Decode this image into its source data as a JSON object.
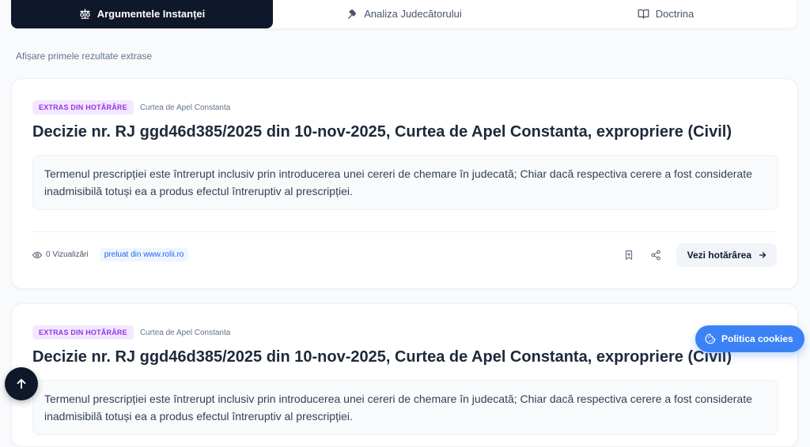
{
  "tabs": [
    {
      "label": "Argumentele Instanței",
      "icon": "scale-icon",
      "active": true
    },
    {
      "label": "Analiza Judecătorului",
      "icon": "gavel-icon",
      "active": false
    },
    {
      "label": "Doctrina",
      "icon": "book-icon",
      "active": false
    }
  ],
  "subtitle": "Afișare primele rezultate extrase",
  "results": [
    {
      "badge": "EXTRAS DIN HOTĂRÂRE",
      "court": "Curtea de Apel Constanta",
      "title": "Decizie nr. RJ ggd46d385/2025 din 10-nov-2025, Curtea de Apel Constanta, expropriere (Civil)",
      "excerpt": "Termenul prescripției este întrerupt inclusiv prin introducerea unei cereri de chemare în judecată; Chiar dacă respectiva cerere a fost considerate inadmisibilă totuși ea a produs efectul întreruptiv al prescripției.",
      "views": "0 Vizualizări",
      "source": "preluat din www.rolii.ro",
      "view_button": "Vezi hotărârea"
    },
    {
      "badge": "EXTRAS DIN HOTĂRÂRE",
      "court": "Curtea de Apel Constanta",
      "title": "Decizie nr. RJ ggd46d385/2025 din 10-nov-2025, Curtea de Apel Constanta, expropriere (Civil)",
      "excerpt": "Termenul prescripției este întrerupt inclusiv prin introducerea unei cereri de chemare în judecată; Chiar dacă respectiva cerere a fost considerate inadmisibilă totuși ea a produs efectul întreruptiv al prescripției."
    }
  ],
  "cookie_button": "Politica cookies",
  "colors": {
    "accent": "#3b82f6",
    "dark": "#0f172a",
    "badge_text": "#9333ea",
    "badge_bg": "#f3e8ff"
  }
}
